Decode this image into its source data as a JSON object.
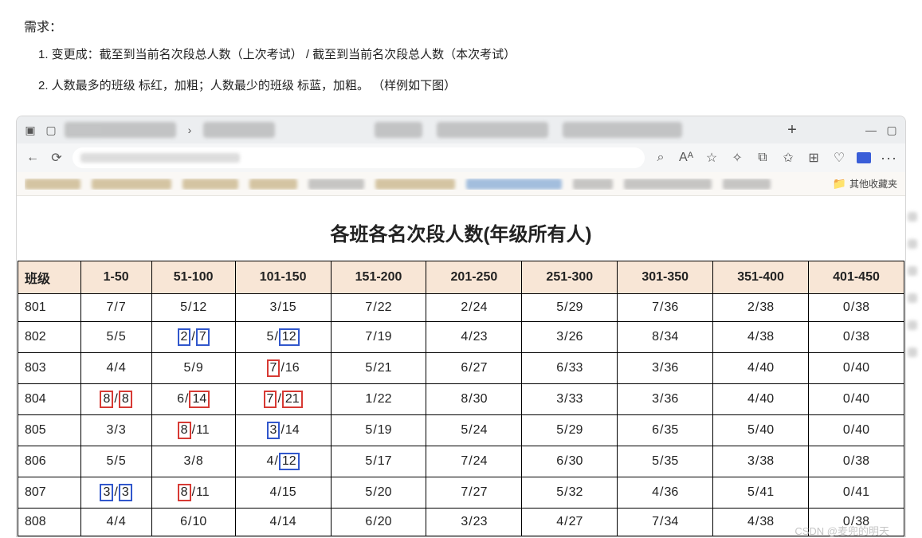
{
  "requirements": {
    "title": "需求：",
    "items": [
      "1. 变更成：截至到当前名次段总人数（上次考试） / 截至到当前名次段总人数（本次考试）",
      "2. 人数最多的班级 标红，加粗；人数最少的班级 标蓝，加粗。 （样例如下图）"
    ]
  },
  "browser": {
    "tab_add": "+",
    "win_min": "—",
    "win_max": "▢",
    "back": "←",
    "refresh": "⟳",
    "search": "⌕",
    "font": "Aᴬ",
    "fav": "☆",
    "ext": "✧",
    "app": "⧉",
    "fav2": "✩",
    "wallet": "⊞",
    "heart": "♡",
    "more": "···",
    "other_bookmarks": "其他收藏夹",
    "folder_glyph": "📁"
  },
  "page": {
    "title": "各班各名次段人数(年级所有人)"
  },
  "table": {
    "head_first": "班级",
    "ranges": [
      "1-50",
      "51-100",
      "101-150",
      "151-200",
      "201-250",
      "251-300",
      "301-350",
      "351-400",
      "401-450"
    ],
    "rows": [
      {
        "cls": "801",
        "cells": [
          {
            "a": "7",
            "b": "7"
          },
          {
            "a": "5",
            "b": "12"
          },
          {
            "a": "3",
            "b": "15"
          },
          {
            "a": "7",
            "b": "22"
          },
          {
            "a": "2",
            "b": "24"
          },
          {
            "a": "5",
            "b": "29"
          },
          {
            "a": "7",
            "b": "36"
          },
          {
            "a": "2",
            "b": "38"
          },
          {
            "a": "0",
            "b": "38"
          }
        ]
      },
      {
        "cls": "802",
        "cells": [
          {
            "a": "5",
            "b": "5"
          },
          {
            "a": "2",
            "ma": "blue",
            "b": "7",
            "mb": "blue"
          },
          {
            "a": "5",
            "b": "12",
            "mb": "blue"
          },
          {
            "a": "7",
            "b": "19"
          },
          {
            "a": "4",
            "b": "23"
          },
          {
            "a": "3",
            "b": "26"
          },
          {
            "a": "8",
            "b": "34"
          },
          {
            "a": "4",
            "b": "38"
          },
          {
            "a": "0",
            "b": "38"
          }
        ]
      },
      {
        "cls": "803",
        "cells": [
          {
            "a": "4",
            "b": "4"
          },
          {
            "a": "5",
            "b": "9"
          },
          {
            "a": "7",
            "ma": "red",
            "b": "16"
          },
          {
            "a": "5",
            "b": "21"
          },
          {
            "a": "6",
            "b": "27"
          },
          {
            "a": "6",
            "b": "33"
          },
          {
            "a": "3",
            "b": "36"
          },
          {
            "a": "4",
            "b": "40"
          },
          {
            "a": "0",
            "b": "40"
          }
        ]
      },
      {
        "cls": "804",
        "cells": [
          {
            "a": "8",
            "ma": "red",
            "b": "8",
            "mb": "red"
          },
          {
            "a": "6",
            "b": "14",
            "mb": "red"
          },
          {
            "a": "7",
            "ma": "red",
            "b": "21",
            "mb": "red"
          },
          {
            "a": "1",
            "b": "22"
          },
          {
            "a": "8",
            "b": "30"
          },
          {
            "a": "3",
            "b": "33"
          },
          {
            "a": "3",
            "b": "36"
          },
          {
            "a": "4",
            "b": "40"
          },
          {
            "a": "0",
            "b": "40"
          }
        ]
      },
      {
        "cls": "805",
        "cells": [
          {
            "a": "3",
            "b": "3"
          },
          {
            "a": "8",
            "ma": "red",
            "b": "11"
          },
          {
            "a": "3",
            "ma": "blue",
            "b": "14"
          },
          {
            "a": "5",
            "b": "19"
          },
          {
            "a": "5",
            "b": "24"
          },
          {
            "a": "5",
            "b": "29"
          },
          {
            "a": "6",
            "b": "35"
          },
          {
            "a": "5",
            "b": "40"
          },
          {
            "a": "0",
            "b": "40"
          }
        ]
      },
      {
        "cls": "806",
        "cells": [
          {
            "a": "5",
            "b": "5"
          },
          {
            "a": "3",
            "b": "8"
          },
          {
            "a": "4",
            "b": "12",
            "mb": "blue"
          },
          {
            "a": "5",
            "b": "17"
          },
          {
            "a": "7",
            "b": "24"
          },
          {
            "a": "6",
            "b": "30"
          },
          {
            "a": "5",
            "b": "35"
          },
          {
            "a": "3",
            "b": "38"
          },
          {
            "a": "0",
            "b": "38"
          }
        ]
      },
      {
        "cls": "807",
        "cells": [
          {
            "a": "3",
            "ma": "blue",
            "b": "3",
            "mb": "blue"
          },
          {
            "a": "8",
            "ma": "red",
            "b": "11"
          },
          {
            "a": "4",
            "b": "15"
          },
          {
            "a": "5",
            "b": "20"
          },
          {
            "a": "7",
            "b": "27"
          },
          {
            "a": "5",
            "b": "32"
          },
          {
            "a": "4",
            "b": "36"
          },
          {
            "a": "5",
            "b": "41"
          },
          {
            "a": "0",
            "b": "41"
          }
        ]
      },
      {
        "cls": "808",
        "cells": [
          {
            "a": "4",
            "b": "4"
          },
          {
            "a": "6",
            "b": "10"
          },
          {
            "a": "4",
            "b": "14"
          },
          {
            "a": "6",
            "b": "20"
          },
          {
            "a": "3",
            "b": "23"
          },
          {
            "a": "4",
            "b": "27"
          },
          {
            "a": "7",
            "b": "34"
          },
          {
            "a": "4",
            "b": "38"
          },
          {
            "a": "0",
            "b": "38"
          }
        ]
      }
    ]
  },
  "watermark": "CSDN @麦兜的明天"
}
